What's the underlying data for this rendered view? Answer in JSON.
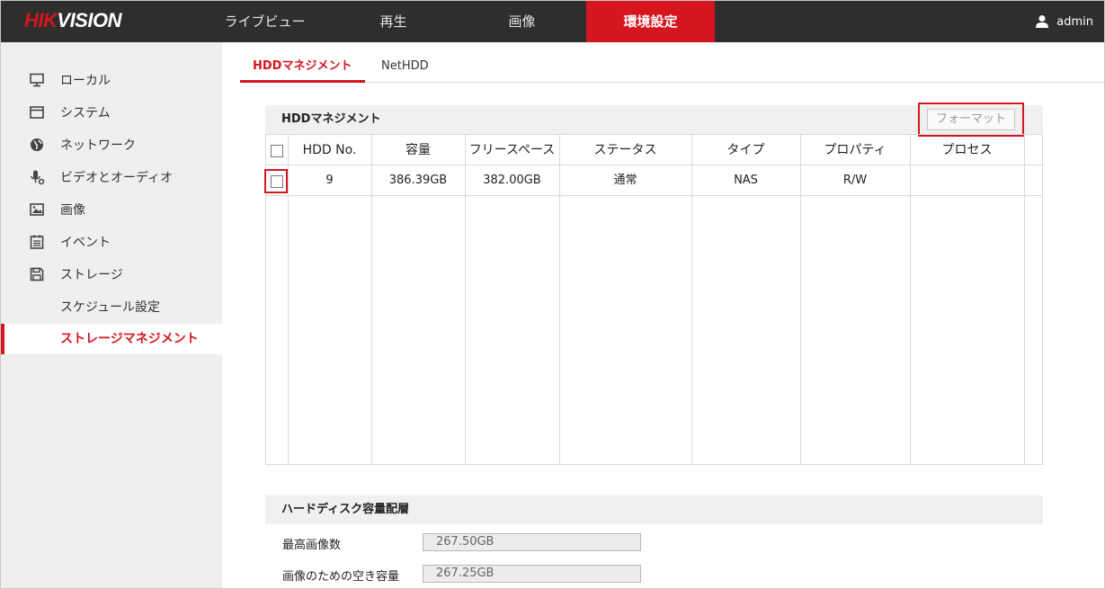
{
  "brand": {
    "logo_part1": "HIK",
    "logo_part2": "VISION"
  },
  "nav": {
    "items": [
      {
        "label": "ライブビュー"
      },
      {
        "label": "再生"
      },
      {
        "label": "画像"
      },
      {
        "label": "環境設定"
      }
    ],
    "active_index": 3
  },
  "user": {
    "name": "admin"
  },
  "sidebar": {
    "items": [
      {
        "label": "ローカル",
        "icon": "monitor-icon"
      },
      {
        "label": "システム",
        "icon": "system-icon"
      },
      {
        "label": "ネットワーク",
        "icon": "globe-icon"
      },
      {
        "label": "ビデオとオーディオ",
        "icon": "mic-icon"
      },
      {
        "label": "画像",
        "icon": "image-icon"
      },
      {
        "label": "イベント",
        "icon": "calendar-icon"
      },
      {
        "label": "ストレージ",
        "icon": "save-icon"
      }
    ],
    "subitems": [
      {
        "label": "スケジュール設定"
      },
      {
        "label": "ストレージマネジメント"
      }
    ],
    "active_subitem": 1
  },
  "tabs": [
    {
      "label": "HDDマネジメント"
    },
    {
      "label": "NetHDD"
    }
  ],
  "hdd_section": {
    "title": "HDDマネジメント",
    "format_button": "フォーマット",
    "columns": [
      "HDD No.",
      "容量",
      "フリースペース",
      "ステータス",
      "タイプ",
      "プロパティ",
      "プロセス"
    ],
    "rows": [
      {
        "hdd_no": "9",
        "capacity": "386.39GB",
        "free": "382.00GB",
        "status": "通常",
        "type": "NAS",
        "property": "R/W",
        "process": ""
      }
    ]
  },
  "capacity_section": {
    "title": "ハードディスク容量配層",
    "fields": [
      {
        "label": "最高画像数",
        "value": "267.50GB"
      },
      {
        "label": "画像のための空き容量",
        "value": "267.25GB"
      }
    ]
  },
  "colors": {
    "accent": "#d6161e",
    "topbar": "#2e2e2e",
    "sidebar": "#efefef"
  }
}
